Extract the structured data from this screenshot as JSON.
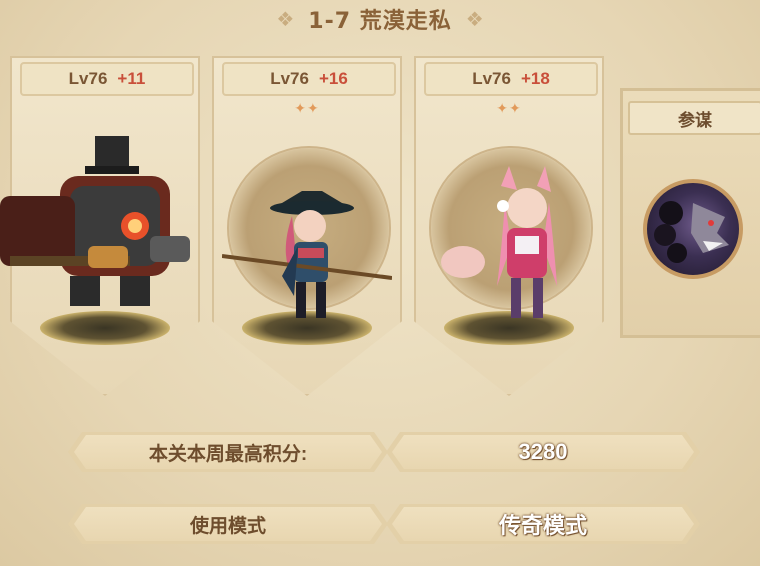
{
  "stage": {
    "title": "1-7 荒漠走私"
  },
  "heroes": [
    {
      "level": "Lv76",
      "plus": "+11",
      "stars": "",
      "icon": "mech-warrior-icon"
    },
    {
      "level": "Lv76",
      "plus": "+16",
      "stars": "✦✦",
      "icon": "ronin-girl-icon"
    },
    {
      "level": "Lv76",
      "plus": "+18",
      "stars": "✦✦",
      "icon": "fox-girl-icon"
    }
  ],
  "advisor": {
    "label": "参谋",
    "icon": "dark-wolf-icon"
  },
  "score": {
    "label": "本关本周最高积分:",
    "value": "3280"
  },
  "mode": {
    "label": "使用模式",
    "value": "传奇模式"
  },
  "colors": {
    "accent": "#c94f3a",
    "text": "#6e4d2d",
    "frame": "#d7c29a"
  }
}
